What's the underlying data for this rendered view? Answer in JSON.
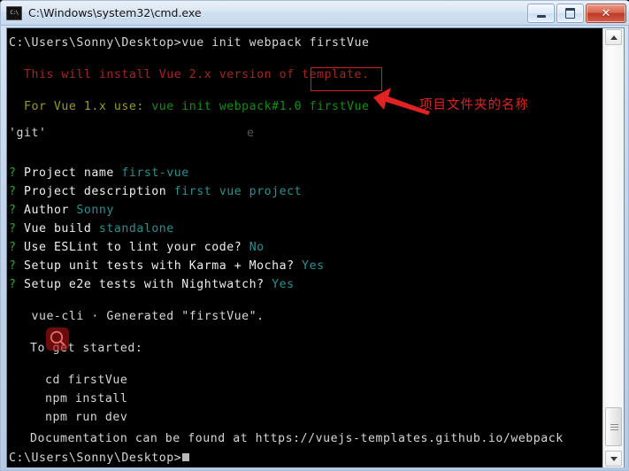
{
  "window": {
    "title": "C:\\Windows\\system32\\cmd.exe",
    "icon_label": "C:\\",
    "icon_name": "cmd-icon",
    "buttons": {
      "minimize": "minimize",
      "maximize": "maximize",
      "close": "✕"
    }
  },
  "console": {
    "background_color": "#000000",
    "lines": [
      {
        "text": "C:\\Users\\Sonny\\Desktop>vue init webpack firstVue",
        "color_name": "white"
      },
      {
        "text": "",
        "color_name": "white"
      },
      {
        "text": "  This will install Vue 2.x version of template.",
        "color_name": "dark-red"
      },
      {
        "text": "",
        "color_name": "white"
      },
      {
        "text": "  For Vue 1.x use: ",
        "color_name": "olive",
        "suffix": "vue init webpack#1.0 firstVue",
        "suffix_color": "green"
      },
      {
        "text": "",
        "color_name": "white"
      },
      {
        "text": "'git'",
        "color_name": "white"
      },
      {
        "text": "",
        "color_name": "white"
      },
      {
        "text": "",
        "color_name": "white"
      },
      {
        "text": "? Project name ",
        "answer": "first-vue"
      },
      {
        "text": "? Project description ",
        "answer": "first vue project"
      },
      {
        "text": "? Author ",
        "answer": "Sonny"
      },
      {
        "text": "? Vue build ",
        "answer": "standalone"
      },
      {
        "text": "? Use ESLint to lint your code? ",
        "answer": "No"
      },
      {
        "text": "? Setup unit tests with Karma + Mocha? ",
        "answer": "Yes"
      },
      {
        "text": "? Setup e2e tests with Nightwatch? ",
        "answer": "Yes"
      }
    ],
    "stray_char": "e",
    "generated_line": "   vue-cli · Generated \"firstVue\".",
    "get_started_line": "To get started:",
    "commands": [
      "  cd firstVue",
      "  npm install",
      "  npm run dev"
    ],
    "docs_line": "Documentation can be found at https://vuejs-templates.github.io/webpack",
    "final_prompt": "C:\\Users\\Sonny\\Desktop>"
  },
  "annotations": {
    "focus_box_target": "firstVue",
    "note_text": "项目文件夹的名称",
    "note_color": "#e02222",
    "arrow_color": "#e02222",
    "magnifier_overlay_color": "#aa1414"
  },
  "scrollbar": {
    "up_arrow": "▲",
    "down_arrow": "▼",
    "thumb_position": "near-bottom"
  }
}
